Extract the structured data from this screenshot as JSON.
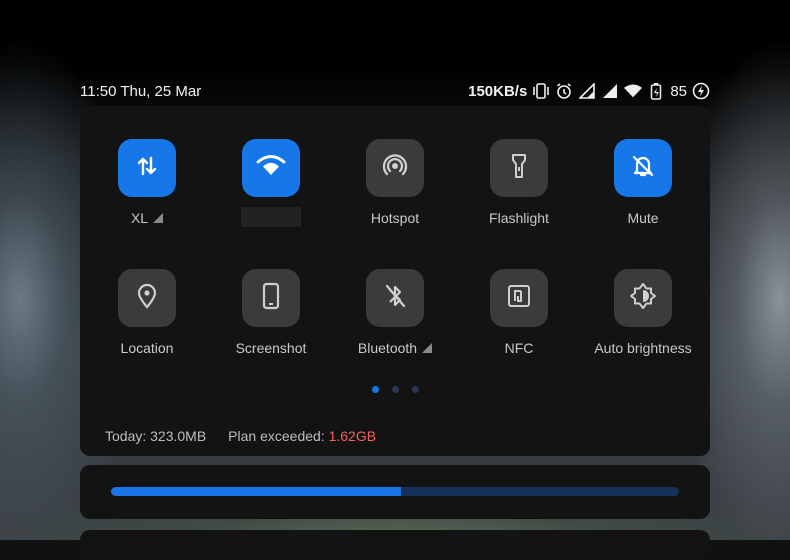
{
  "status_bar": {
    "time_date": "11:50 Thu, 25 Mar",
    "net_speed": "150KB/s",
    "battery_level": "85",
    "icons": [
      "vibrate-icon",
      "alarm-icon",
      "signal-icon",
      "signal-icon",
      "wifi-icon",
      "battery-icon",
      "charging-icon"
    ]
  },
  "toggles": [
    {
      "label": "XL",
      "icon": "mobile-data-icon",
      "active": true,
      "signal": true
    },
    {
      "label": "",
      "icon": "wifi-icon",
      "active": true,
      "redacted": true
    },
    {
      "label": "Hotspot",
      "icon": "hotspot-icon",
      "active": false
    },
    {
      "label": "Flashlight",
      "icon": "flashlight-icon",
      "active": false
    },
    {
      "label": "Mute",
      "icon": "mute-bell-icon",
      "active": true
    },
    {
      "label": "Location",
      "icon": "location-icon",
      "active": false
    },
    {
      "label": "Screenshot",
      "icon": "screenshot-icon",
      "active": false
    },
    {
      "label": "Bluetooth",
      "icon": "bluetooth-icon",
      "active": false,
      "signal": true
    },
    {
      "label": "NFC",
      "icon": "nfc-icon",
      "active": false
    },
    {
      "label": "Auto brightness",
      "icon": "auto-brightness-icon",
      "active": false
    }
  ],
  "pager": {
    "pages": 3,
    "current": 1
  },
  "usage": {
    "today_label": "Today: 323.0MB",
    "plan_label": "Plan exceeded:",
    "plan_value": "1.62GB"
  },
  "brightness": {
    "level": 0.51
  },
  "colors": {
    "accent": "#1677e8",
    "tile_off": "#3b3b3b",
    "panel": "#131313",
    "warning": "#f0625a"
  }
}
